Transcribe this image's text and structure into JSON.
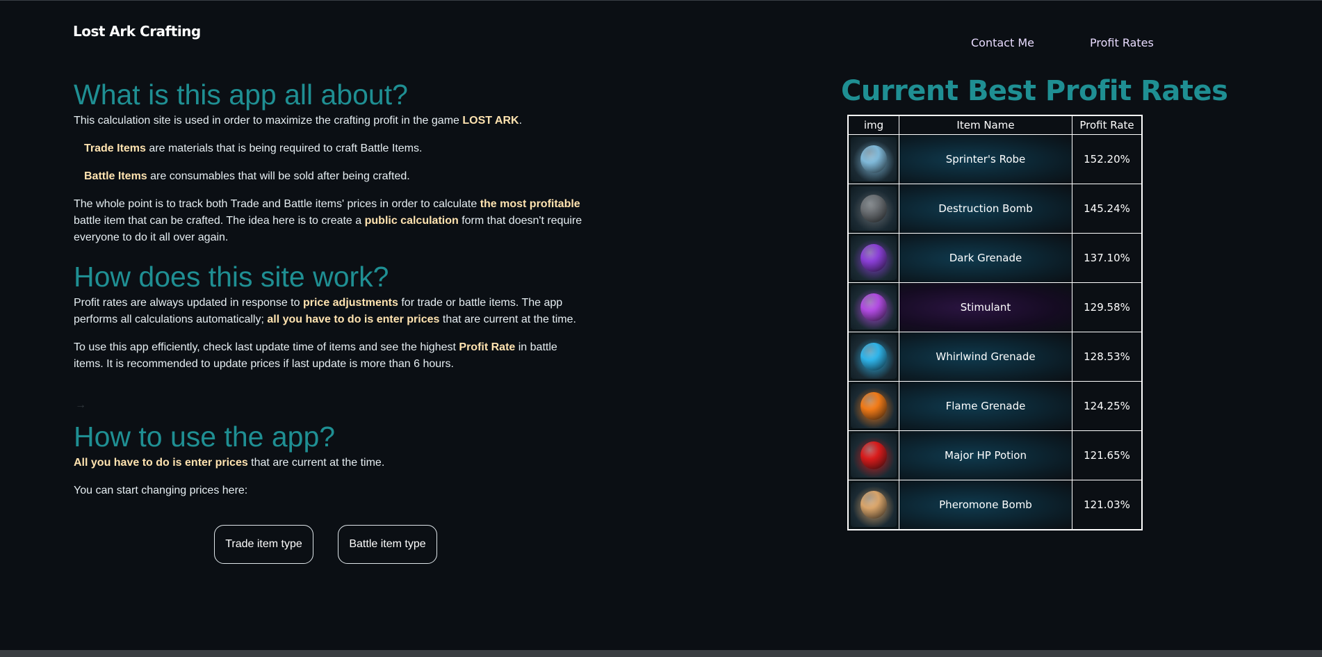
{
  "brand": "Lost Ark Crafting",
  "nav": {
    "contact": "Contact Me",
    "rates": "Profit Rates"
  },
  "about": {
    "title": "What is this app all about?",
    "p1a": "This calculation site is used in order to maximize the crafting profit in the game ",
    "p1b": "LOST ARK",
    "p1c": ".",
    "trade_b": "Trade Items",
    "trade_t": " are materials that is being required to craft Battle Items.",
    "battle_b": "Battle Items",
    "battle_t": " are consumables that will be sold after being crafted.",
    "p4a": "The whole point is to track both Trade and Battle items' prices in order to calculate ",
    "p4b": "the most profitable",
    "p4c": " battle item that can be crafted. The idea here is to create a ",
    "p4d": "public calculation",
    "p4e": " form that doesn't require everyone to do it all over again."
  },
  "how": {
    "title": "How does this site work?",
    "p1a": "Profit rates are always updated in response to ",
    "p1b": "price adjustments",
    "p1c": " for trade or battle items. The app performs all calculations automatically; ",
    "p1d": "all you have to do is enter prices",
    "p1e": " that are current at the time.",
    "p2a": "To use this app efficiently, check last update time of items and see the highest ",
    "p2b": "Profit Rate",
    "p2c": " in battle items. It is recommended to update prices if last update is more than 6 hours."
  },
  "arrow": "→",
  "use": {
    "title": "How to use the app?",
    "p1b": "All you have to do is enter prices",
    "p1c": " that are current at the time.",
    "p2": "You can start changing prices here:"
  },
  "buttons": {
    "trade": "Trade item type",
    "battle": "Battle item type"
  },
  "rates": {
    "title": "Current Best Profit Rates",
    "headers": {
      "img": "img",
      "name": "Item Name",
      "rate": "Profit Rate"
    },
    "rows": [
      {
        "name": "Sprinter's Robe",
        "rate": "152.20%",
        "icon": "robe-icon",
        "color": "#7fb8d8"
      },
      {
        "name": "Destruction Bomb",
        "rate": "145.24%",
        "icon": "bomb-icon",
        "color": "#6b6f73"
      },
      {
        "name": "Dark Grenade",
        "rate": "137.10%",
        "icon": "dark-grenade-icon",
        "color": "#8a3fd6"
      },
      {
        "name": "Stimulant",
        "rate": "129.58%",
        "icon": "stimulant-icon",
        "color": "#b04be0"
      },
      {
        "name": "Whirlwind Grenade",
        "rate": "128.53%",
        "icon": "whirlwind-grenade-icon",
        "color": "#2fb3e8"
      },
      {
        "name": "Flame Grenade",
        "rate": "124.25%",
        "icon": "flame-grenade-icon",
        "color": "#f07a18"
      },
      {
        "name": "Major HP Potion",
        "rate": "121.65%",
        "icon": "hp-potion-icon",
        "color": "#d81c1c"
      },
      {
        "name": "Pheromone Bomb",
        "rate": "121.03%",
        "icon": "pheromone-bomb-icon",
        "color": "#d8a46a"
      }
    ]
  }
}
